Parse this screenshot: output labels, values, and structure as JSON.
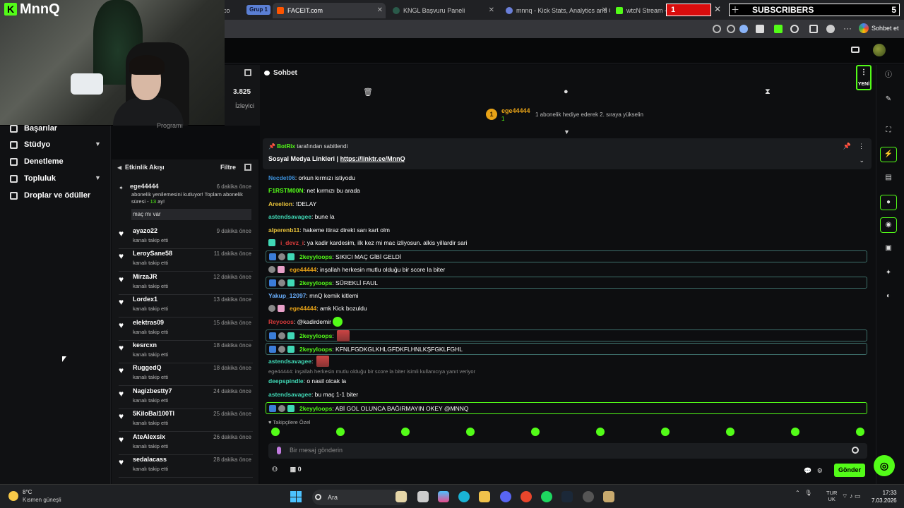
{
  "browser": {
    "group_label": "Grup 1",
    "tabs": [
      {
        "label": "co"
      },
      {
        "label": "FACEIT.com"
      },
      {
        "label": "KNGL Başvuru Paneli"
      },
      {
        "label": "mnnq - Kick Stats, Analytics and C"
      },
      {
        "label": "wtcN Stream -"
      }
    ],
    "chat_label": "Sohbet et"
  },
  "overlay": {
    "counter": "1",
    "subscribers_label": "SUBSCRIBERS",
    "subscribers_count": "5"
  },
  "channel": {
    "logo_text": "MnnQ",
    "viewers": "3.825",
    "viewers_label": "İzleyici",
    "program_label": "Programı"
  },
  "sidebar": {
    "items": [
      {
        "label": "Başarılar"
      },
      {
        "label": "Stüdyo"
      },
      {
        "label": "Denetleme"
      },
      {
        "label": "Topluluk"
      },
      {
        "label": "Droplar ve ödüller"
      }
    ]
  },
  "feed": {
    "title": "Etkinlik Akışı",
    "filter": "Filtre",
    "first": {
      "user": "ege44444",
      "time": "6 dakika önce",
      "text_a": "abonelik yenilemesini kutluyor! Toplam abonelik",
      "text_b": "süresi - ",
      "months": "13",
      "text_c": " ay!",
      "message": "maç mı var"
    },
    "items": [
      {
        "user": "ayazo22",
        "time": "9 dakika önce",
        "sub": "kanalı takip etti"
      },
      {
        "user": "LeroySane58",
        "time": "11 dakika önce",
        "sub": "kanalı takip etti"
      },
      {
        "user": "MirzaJR",
        "time": "12 dakika önce",
        "sub": "kanalı takip etti"
      },
      {
        "user": "Lordex1",
        "time": "13 dakika önce",
        "sub": "kanalı takip etti"
      },
      {
        "user": "elektras09",
        "time": "15 dakika önce",
        "sub": "kanalı takip etti"
      },
      {
        "user": "kesrcxn",
        "time": "18 dakika önce",
        "sub": "kanalı takip etti"
      },
      {
        "user": "RuggedQ",
        "time": "18 dakika önce",
        "sub": "kanalı takip etti"
      },
      {
        "user": "Nagizbestty7",
        "time": "24 dakika önce",
        "sub": "kanalı takip etti"
      },
      {
        "user": "5KiloBal100Tl",
        "time": "25 dakika önce",
        "sub": "kanalı takip etti"
      },
      {
        "user": "AteAlexsix",
        "time": "26 dakika önce",
        "sub": "kanalı takip etti"
      },
      {
        "user": "sedalacass",
        "time": "28 dakika önce",
        "sub": "kanalı takip etti"
      }
    ]
  },
  "chat": {
    "title": "Sohbet",
    "menu_new": "YENİ",
    "gift": {
      "rank": "1",
      "user": "ege44444",
      "count": "1",
      "message": "1 abonelik hediye ederek 2. sıraya yükselin"
    },
    "pinned": {
      "bot": "BotRix",
      "by": " tarafından sabitlendi",
      "text": "Sosyal Medya Linkleri | ",
      "link": "https://linktr.ee/MnnQ"
    },
    "messages": [
      {
        "user": "Necdet06",
        "text": ": orkun kırmızı istiyodu",
        "color": "#3b8fd9"
      },
      {
        "user": "F1RSTM00N",
        "text": ": net kırmızı bu arada",
        "color": "#53fc18"
      },
      {
        "user": "Areelion",
        "text": ": !DELAY",
        "color": "#e8c23a"
      },
      {
        "user": "astendsavagee",
        "text": ": bune la",
        "color": "#40d9b6"
      },
      {
        "user": "alperenb11",
        "text": ": hakeme itiraz direkt sarı kart olm",
        "color": "#e8c23a"
      },
      {
        "user": "i_devz_i",
        "text": ": ya kadir kardesim, ilk kez mi mac izliyosun. alkis yillardir sari",
        "color": "#d93b3b"
      },
      {
        "user": "2keyyloops",
        "text": ": SIKICI MAÇ GİBİ GELDİ",
        "color": "#53fc18"
      },
      {
        "user": "ege44444",
        "text": ": inşallah herkesin mutlu olduğu bir score la biter",
        "color": "#e8a317"
      },
      {
        "user": "2keyyloops",
        "text": ": SÜREKLİ FAUL",
        "color": "#53fc18"
      },
      {
        "user": "Yakup_12097",
        "text": ": mnQ kemik kitlemi",
        "color": "#6ab0ff"
      },
      {
        "user": "ege44444",
        "text": ": amk Kick bozuldu",
        "color": "#e8a317"
      },
      {
        "user": "Reyooos",
        "text": ": @kadirdemir",
        "color": "#d93b3b"
      },
      {
        "user": "2keyyloops",
        "text": ":",
        "color": "#53fc18"
      },
      {
        "user": "2keyyloops",
        "text": ": KFNLFGDKGLKHLGFDKFLHNLKŞFGKLFGHL",
        "color": "#53fc18"
      },
      {
        "user": "astendsavagee",
        "text": ":",
        "color": "#40d9b6"
      },
      {
        "user": "deepspindle",
        "text": ": o nasil olcak la",
        "color": "#40d9b6"
      },
      {
        "user": "astendsavagee",
        "text": ": bu maç 1-1 biter",
        "color": "#40d9b6"
      },
      {
        "user": "2keyyloops",
        "text": ": ABİ GOL OLUNCA BAĞIRMAYIN OKEY @MNNQ",
        "color": "#53fc18"
      }
    ],
    "reply": "ege44444: inşallah herkesin mutlu olduğu bir score la biter isimli kullanıcıya yanıt veriyor",
    "followers_label": "Takipçilere Özel",
    "input_placeholder": "Bir mesaj gönderin",
    "points": "0",
    "send_label": "Gönder"
  },
  "taskbar": {
    "temp": "8°C",
    "weather": "Kısmen güneşli",
    "search": "Ara",
    "lang_a": "TUR",
    "lang_b": "UK",
    "time": "17:33",
    "date": "7.03.2026"
  }
}
